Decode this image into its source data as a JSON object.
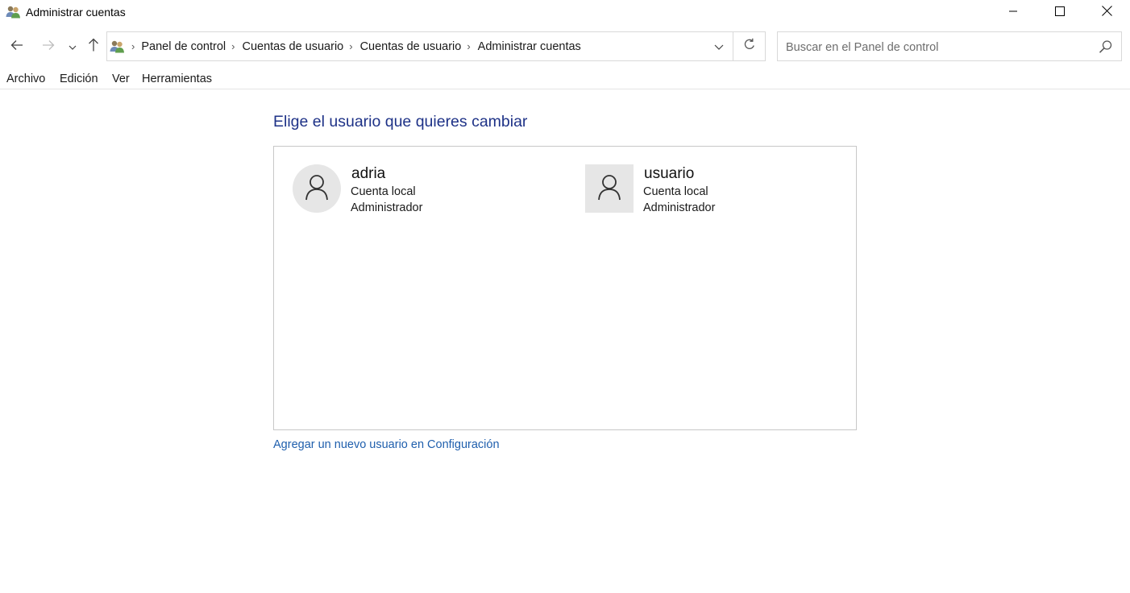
{
  "window": {
    "title": "Administrar cuentas",
    "icons": {
      "app": "users-icon",
      "minimize": "minimize-icon",
      "maximize": "maximize-icon",
      "close": "close-icon"
    }
  },
  "navigation": {
    "icons": {
      "back": "arrow-left-icon",
      "forward": "arrow-right-icon",
      "recent": "chevron-down-icon",
      "up": "arrow-up-icon"
    },
    "address": {
      "icon": "users-icon",
      "breadcrumbs": [
        "Panel de control",
        "Cuentas de usuario",
        "Cuentas de usuario",
        "Administrar cuentas"
      ],
      "dropdown_icon": "chevron-down-icon",
      "refresh_icon": "refresh-icon"
    },
    "search": {
      "placeholder": "Buscar en el Panel de control",
      "value": "",
      "icon": "search-icon"
    }
  },
  "menu": {
    "items": [
      "Archivo",
      "Edición",
      "Ver",
      "Herramientas"
    ]
  },
  "main": {
    "heading": "Elige el usuario que quieres cambiar",
    "users": [
      {
        "name": "adria",
        "type": "Cuenta local",
        "role": "Administrador",
        "avatar_icon": "user-icon",
        "avatar_shape": "circle"
      },
      {
        "name": "usuario",
        "type": "Cuenta local",
        "role": "Administrador",
        "avatar_icon": "user-icon",
        "avatar_shape": "square"
      }
    ],
    "add_user_link": "Agregar un nuevo usuario en Configuración"
  },
  "colors": {
    "heading": "#1e3287",
    "link": "#1f5fad",
    "border": "#c8c8c8",
    "avatar_bg": "#e6e6e6"
  }
}
